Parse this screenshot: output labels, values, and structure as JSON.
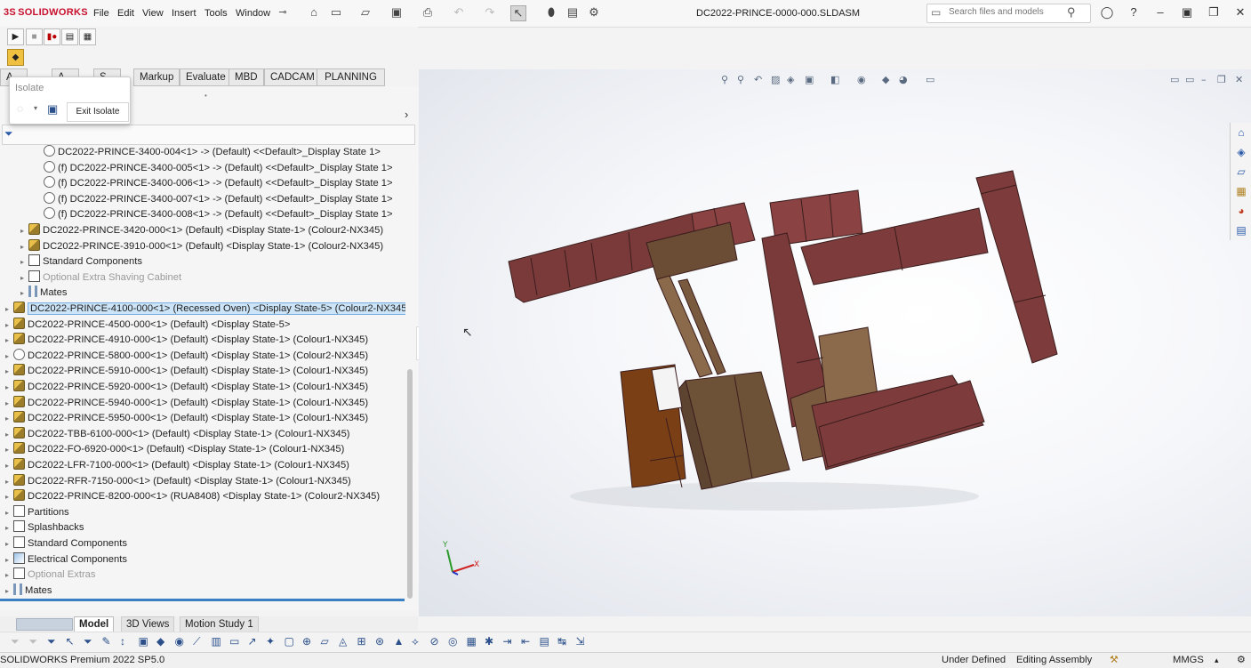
{
  "app": {
    "name": "SOLIDWORKS",
    "document_title": "DC2022-PRINCE-0000-000.SLDASM"
  },
  "menu": [
    "File",
    "Edit",
    "View",
    "Insert",
    "Tools",
    "Window"
  ],
  "search": {
    "placeholder": "Search files and models"
  },
  "command_tabs": [
    "A",
    "A",
    "S",
    "Markup",
    "Evaluate",
    "MBD",
    "CADCAM",
    "PLANNING"
  ],
  "isolate": {
    "title": "Isolate",
    "exit_label": "Exit Isolate"
  },
  "tree": [
    {
      "indent": 2,
      "icon": "part",
      "label": "DC2022-PRINCE-3400-004<1> -> (Default) <<Default>_Display State 1>",
      "expandable": false
    },
    {
      "indent": 2,
      "icon": "part",
      "label": "(f) DC2022-PRINCE-3400-005<1> -> (Default) <<Default>_Display State 1>",
      "expandable": false
    },
    {
      "indent": 2,
      "icon": "part",
      "label": "(f) DC2022-PRINCE-3400-006<1> -> (Default) <<Default>_Display State 1>",
      "expandable": false
    },
    {
      "indent": 2,
      "icon": "part",
      "label": "(f) DC2022-PRINCE-3400-007<1> -> (Default) <<Default>_Display State 1>",
      "expandable": false
    },
    {
      "indent": 2,
      "icon": "part",
      "label": "(f) DC2022-PRINCE-3400-008<1> -> (Default) <<Default>_Display State 1>",
      "expandable": false
    },
    {
      "indent": 1,
      "icon": "asm",
      "label": "DC2022-PRINCE-3420-000<1> (Default) <Display State-1> (Colour2-NX345)",
      "expandable": true
    },
    {
      "indent": 1,
      "icon": "asm",
      "label": "DC2022-PRINCE-3910-000<1> (Default) <Display State-1> (Colour2-NX345)",
      "expandable": true
    },
    {
      "indent": 1,
      "icon": "folder",
      "label": "Standard Components",
      "expandable": true
    },
    {
      "indent": 1,
      "icon": "folder",
      "label": "Optional Extra Shaving Cabinet",
      "expandable": true,
      "dim": true
    },
    {
      "indent": 1,
      "icon": "mates",
      "label": "Mates",
      "expandable": true
    },
    {
      "indent": 0,
      "icon": "asm",
      "label": "DC2022-PRINCE-4100-000<1> (Recessed Oven) <Display State-5> (Colour2-NX345)",
      "expandable": true,
      "selected": true
    },
    {
      "indent": 0,
      "icon": "asm",
      "label": "DC2022-PRINCE-4500-000<1> (Default) <Display State-5>",
      "expandable": true
    },
    {
      "indent": 0,
      "icon": "asm",
      "label": "DC2022-PRINCE-4910-000<1> (Default) <Display State-1> (Colour1-NX345)",
      "expandable": true
    },
    {
      "indent": 0,
      "icon": "part",
      "label": "DC2022-PRINCE-5800-000<1> (Default) <Display State-1> (Colour2-NX345)",
      "expandable": true
    },
    {
      "indent": 0,
      "icon": "asm",
      "label": "DC2022-PRINCE-5910-000<1> (Default) <Display State-1> (Colour1-NX345)",
      "expandable": true
    },
    {
      "indent": 0,
      "icon": "asm",
      "label": "DC2022-PRINCE-5920-000<1> (Default) <Display State-1> (Colour1-NX345)",
      "expandable": true
    },
    {
      "indent": 0,
      "icon": "asm",
      "label": "DC2022-PRINCE-5940-000<1> (Default) <Display State-1> (Colour1-NX345)",
      "expandable": true
    },
    {
      "indent": 0,
      "icon": "asm",
      "label": "DC2022-PRINCE-5950-000<1> (Default) <Display State-1> (Colour1-NX345)",
      "expandable": true
    },
    {
      "indent": 0,
      "icon": "asm",
      "label": "DC2022-TBB-6100-000<1> (Default) <Display State-1> (Colour1-NX345)",
      "expandable": true
    },
    {
      "indent": 0,
      "icon": "asm",
      "label": "DC2022-FO-6920-000<1> (Default) <Display State-1> (Colour1-NX345)",
      "expandable": true
    },
    {
      "indent": 0,
      "icon": "asm",
      "label": "DC2022-LFR-7100-000<1> (Default) <Display State-1> (Colour1-NX345)",
      "expandable": true
    },
    {
      "indent": 0,
      "icon": "asm",
      "label": "DC2022-RFR-7150-000<1> (Default) <Display State-1> (Colour1-NX345)",
      "expandable": true
    },
    {
      "indent": 0,
      "icon": "asm",
      "label": "DC2022-PRINCE-8200-000<1> (RUA8408) <Display State-1> (Colour2-NX345)",
      "expandable": true
    },
    {
      "indent": 0,
      "icon": "folder",
      "label": "Partitions",
      "expandable": true
    },
    {
      "indent": 0,
      "icon": "folder",
      "label": "Splashbacks",
      "expandable": true
    },
    {
      "indent": 0,
      "icon": "folder",
      "label": "Standard Components",
      "expandable": true
    },
    {
      "indent": 0,
      "icon": "folder-blue",
      "label": "Electrical Components",
      "expandable": true
    },
    {
      "indent": 0,
      "icon": "folder",
      "label": "Optional Extras",
      "expandable": true,
      "dim": true
    },
    {
      "indent": 0,
      "icon": "mates",
      "label": "Mates",
      "expandable": true
    }
  ],
  "bottom_tabs": [
    "Model",
    "3D Views",
    "Motion Study 1"
  ],
  "status": {
    "product": "SOLIDWORKS Premium 2022 SP5.0",
    "definition": "Under Defined",
    "mode": "Editing Assembly",
    "units": "MMGS"
  },
  "colors": {
    "cabinet_red": "#7d3b3b",
    "cabinet_brown": "#6e5238",
    "cabinet_orange": "#7a3f14",
    "selection": "#cce4f7"
  }
}
